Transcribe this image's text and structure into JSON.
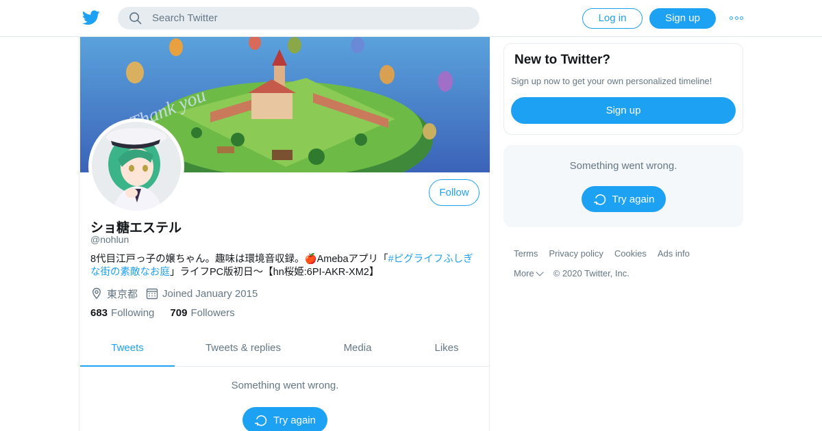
{
  "topbar": {
    "logo_icon": "twitter-bird-icon",
    "search_placeholder": "Search Twitter",
    "login_label": "Log in",
    "signup_label": "Sign up",
    "more_icon": "more-dots-icon"
  },
  "profile": {
    "display_name": "ショ糖エステル",
    "handle": "@nohlun",
    "follow_label": "Follow",
    "bio_text": "8代目江戸っ子の嬢ちゃん。趣味は環境音収録。🍎Amebaアプリ「",
    "bio_link": "#ピグライフふしぎな街の素敵なお庭",
    "bio_after": "」ライフPC版初日〜【hn桜姫:6PI-AKR-XM2】",
    "location": "東京都",
    "joined": "Joined January 2015",
    "following_count": "683",
    "following_label": "Following",
    "followers_count": "709",
    "followers_label": "Followers",
    "banner_text": "Thank you"
  },
  "tabs": [
    {
      "label": "Tweets",
      "active": true
    },
    {
      "label": "Tweets & replies",
      "active": false
    },
    {
      "label": "Media",
      "active": false
    },
    {
      "label": "Likes",
      "active": false
    }
  ],
  "timeline": {
    "error_message": "Something went wrong.",
    "try_again_label": "Try again"
  },
  "sidebar": {
    "signup_card": {
      "title": "New to Twitter?",
      "subtitle": "Sign up now to get your own personalized timeline!",
      "button_label": "Sign up"
    },
    "error_card": {
      "message": "Something went wrong.",
      "try_again_label": "Try again"
    }
  },
  "footer": {
    "terms": "Terms",
    "privacy": "Privacy policy",
    "cookies": "Cookies",
    "ads_info": "Ads info",
    "more": "More",
    "copyright": "© 2020 Twitter, Inc."
  },
  "colors": {
    "accent": "#1da1f2",
    "secondary_text": "#657786",
    "border": "#e6ecf0"
  }
}
